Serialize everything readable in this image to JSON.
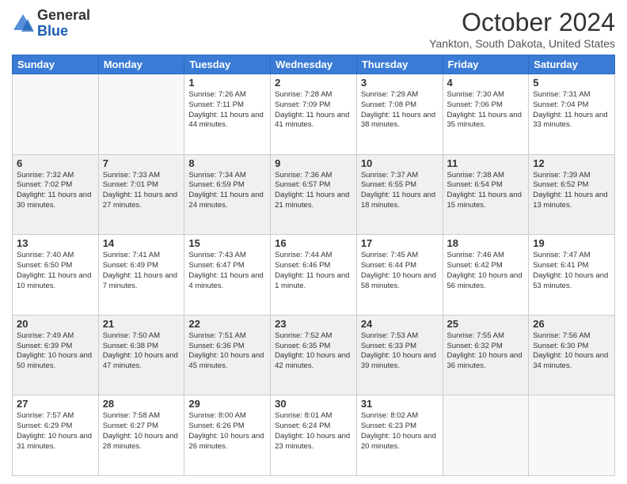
{
  "header": {
    "logo": {
      "general": "General",
      "blue": "Blue"
    },
    "title": "October 2024",
    "location": "Yankton, South Dakota, United States"
  },
  "days_of_week": [
    "Sunday",
    "Monday",
    "Tuesday",
    "Wednesday",
    "Thursday",
    "Friday",
    "Saturday"
  ],
  "weeks": [
    [
      {
        "day": "",
        "info": ""
      },
      {
        "day": "",
        "info": ""
      },
      {
        "day": "1",
        "info": "Sunrise: 7:26 AM\nSunset: 7:11 PM\nDaylight: 11 hours and 44 minutes."
      },
      {
        "day": "2",
        "info": "Sunrise: 7:28 AM\nSunset: 7:09 PM\nDaylight: 11 hours and 41 minutes."
      },
      {
        "day": "3",
        "info": "Sunrise: 7:29 AM\nSunset: 7:08 PM\nDaylight: 11 hours and 38 minutes."
      },
      {
        "day": "4",
        "info": "Sunrise: 7:30 AM\nSunset: 7:06 PM\nDaylight: 11 hours and 35 minutes."
      },
      {
        "day": "5",
        "info": "Sunrise: 7:31 AM\nSunset: 7:04 PM\nDaylight: 11 hours and 33 minutes."
      }
    ],
    [
      {
        "day": "6",
        "info": "Sunrise: 7:32 AM\nSunset: 7:02 PM\nDaylight: 11 hours and 30 minutes."
      },
      {
        "day": "7",
        "info": "Sunrise: 7:33 AM\nSunset: 7:01 PM\nDaylight: 11 hours and 27 minutes."
      },
      {
        "day": "8",
        "info": "Sunrise: 7:34 AM\nSunset: 6:59 PM\nDaylight: 11 hours and 24 minutes."
      },
      {
        "day": "9",
        "info": "Sunrise: 7:36 AM\nSunset: 6:57 PM\nDaylight: 11 hours and 21 minutes."
      },
      {
        "day": "10",
        "info": "Sunrise: 7:37 AM\nSunset: 6:55 PM\nDaylight: 11 hours and 18 minutes."
      },
      {
        "day": "11",
        "info": "Sunrise: 7:38 AM\nSunset: 6:54 PM\nDaylight: 11 hours and 15 minutes."
      },
      {
        "day": "12",
        "info": "Sunrise: 7:39 AM\nSunset: 6:52 PM\nDaylight: 11 hours and 13 minutes."
      }
    ],
    [
      {
        "day": "13",
        "info": "Sunrise: 7:40 AM\nSunset: 6:50 PM\nDaylight: 11 hours and 10 minutes."
      },
      {
        "day": "14",
        "info": "Sunrise: 7:41 AM\nSunset: 6:49 PM\nDaylight: 11 hours and 7 minutes."
      },
      {
        "day": "15",
        "info": "Sunrise: 7:43 AM\nSunset: 6:47 PM\nDaylight: 11 hours and 4 minutes."
      },
      {
        "day": "16",
        "info": "Sunrise: 7:44 AM\nSunset: 6:46 PM\nDaylight: 11 hours and 1 minute."
      },
      {
        "day": "17",
        "info": "Sunrise: 7:45 AM\nSunset: 6:44 PM\nDaylight: 10 hours and 58 minutes."
      },
      {
        "day": "18",
        "info": "Sunrise: 7:46 AM\nSunset: 6:42 PM\nDaylight: 10 hours and 56 minutes."
      },
      {
        "day": "19",
        "info": "Sunrise: 7:47 AM\nSunset: 6:41 PM\nDaylight: 10 hours and 53 minutes."
      }
    ],
    [
      {
        "day": "20",
        "info": "Sunrise: 7:49 AM\nSunset: 6:39 PM\nDaylight: 10 hours and 50 minutes."
      },
      {
        "day": "21",
        "info": "Sunrise: 7:50 AM\nSunset: 6:38 PM\nDaylight: 10 hours and 47 minutes."
      },
      {
        "day": "22",
        "info": "Sunrise: 7:51 AM\nSunset: 6:36 PM\nDaylight: 10 hours and 45 minutes."
      },
      {
        "day": "23",
        "info": "Sunrise: 7:52 AM\nSunset: 6:35 PM\nDaylight: 10 hours and 42 minutes."
      },
      {
        "day": "24",
        "info": "Sunrise: 7:53 AM\nSunset: 6:33 PM\nDaylight: 10 hours and 39 minutes."
      },
      {
        "day": "25",
        "info": "Sunrise: 7:55 AM\nSunset: 6:32 PM\nDaylight: 10 hours and 36 minutes."
      },
      {
        "day": "26",
        "info": "Sunrise: 7:56 AM\nSunset: 6:30 PM\nDaylight: 10 hours and 34 minutes."
      }
    ],
    [
      {
        "day": "27",
        "info": "Sunrise: 7:57 AM\nSunset: 6:29 PM\nDaylight: 10 hours and 31 minutes."
      },
      {
        "day": "28",
        "info": "Sunrise: 7:58 AM\nSunset: 6:27 PM\nDaylight: 10 hours and 28 minutes."
      },
      {
        "day": "29",
        "info": "Sunrise: 8:00 AM\nSunset: 6:26 PM\nDaylight: 10 hours and 26 minutes."
      },
      {
        "day": "30",
        "info": "Sunrise: 8:01 AM\nSunset: 6:24 PM\nDaylight: 10 hours and 23 minutes."
      },
      {
        "day": "31",
        "info": "Sunrise: 8:02 AM\nSunset: 6:23 PM\nDaylight: 10 hours and 20 minutes."
      },
      {
        "day": "",
        "info": ""
      },
      {
        "day": "",
        "info": ""
      }
    ]
  ]
}
